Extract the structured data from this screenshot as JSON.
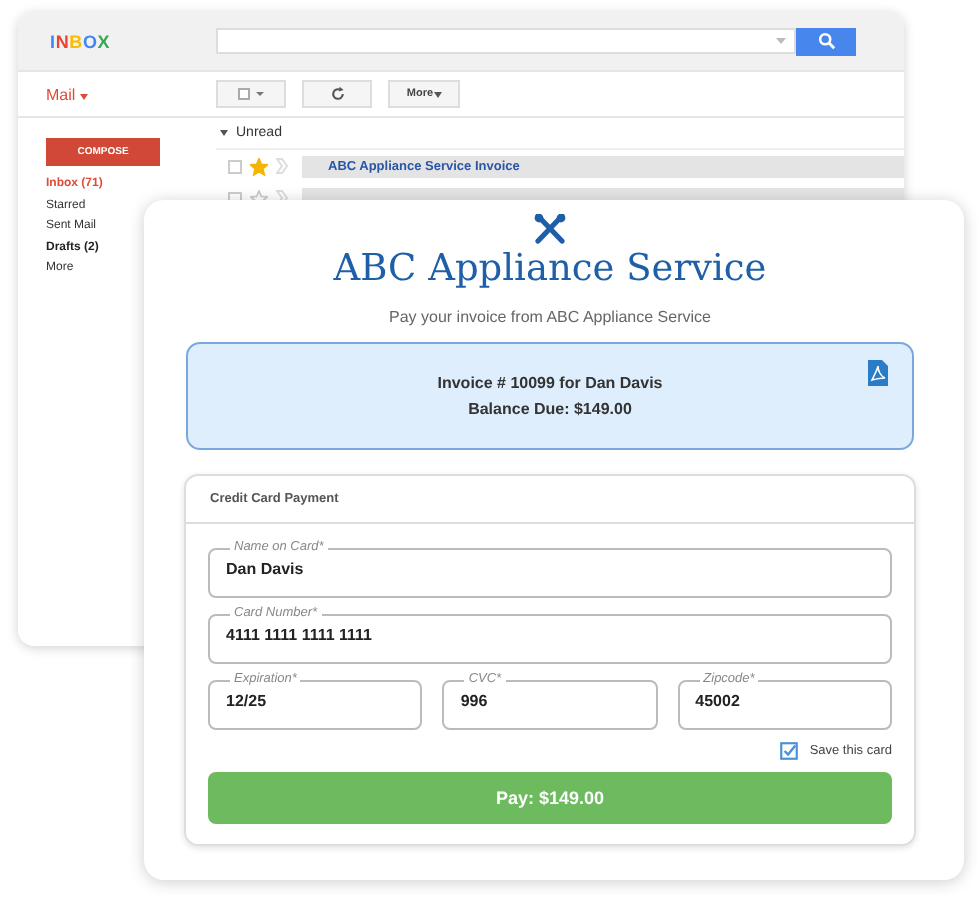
{
  "mail_window": {
    "logo": "INBOX",
    "mail_menu": "Mail",
    "more_button": "More",
    "compose_button": "COMPOSE",
    "folders": [
      {
        "label": "Inbox (71)",
        "selected": true,
        "unread": true
      },
      {
        "label": "Starred",
        "selected": false,
        "unread": false
      },
      {
        "label": "Sent Mail",
        "selected": false,
        "unread": false
      },
      {
        "label": "Drafts (2)",
        "selected": false,
        "unread": true
      },
      {
        "label": "More",
        "selected": false,
        "unread": false
      }
    ],
    "section_header": "Unread",
    "messages": [
      {
        "subject": "ABC Appliance Service Invoice",
        "starred": true,
        "checked": false
      },
      {
        "starred": false,
        "checked": false
      }
    ]
  },
  "payment": {
    "title": "ABC Appliance Service",
    "subtitle": "Pay your invoice from ABC Appliance Service",
    "invoice": {
      "line_1": "Invoice # 10099 for Dan Davis",
      "line_2": "Balance Due: $149.00"
    },
    "card_panel": {
      "title": "Credit Card Payment",
      "field_rows": [
        [
          {
            "label": "Name on Card*",
            "value": "Dan Davis"
          }
        ],
        [
          {
            "label": "Card Number*",
            "value": "4111 1111 1111 1111"
          }
        ],
        [
          {
            "label": "Expiration*",
            "value": "12/25"
          },
          {
            "label": "CVC*",
            "value": "996"
          },
          {
            "label": "Zipcode*",
            "value": "45002"
          }
        ]
      ],
      "save_card": {
        "label": "Save this card",
        "checked": true
      },
      "pay_button": "Pay: $149.00"
    }
  }
}
